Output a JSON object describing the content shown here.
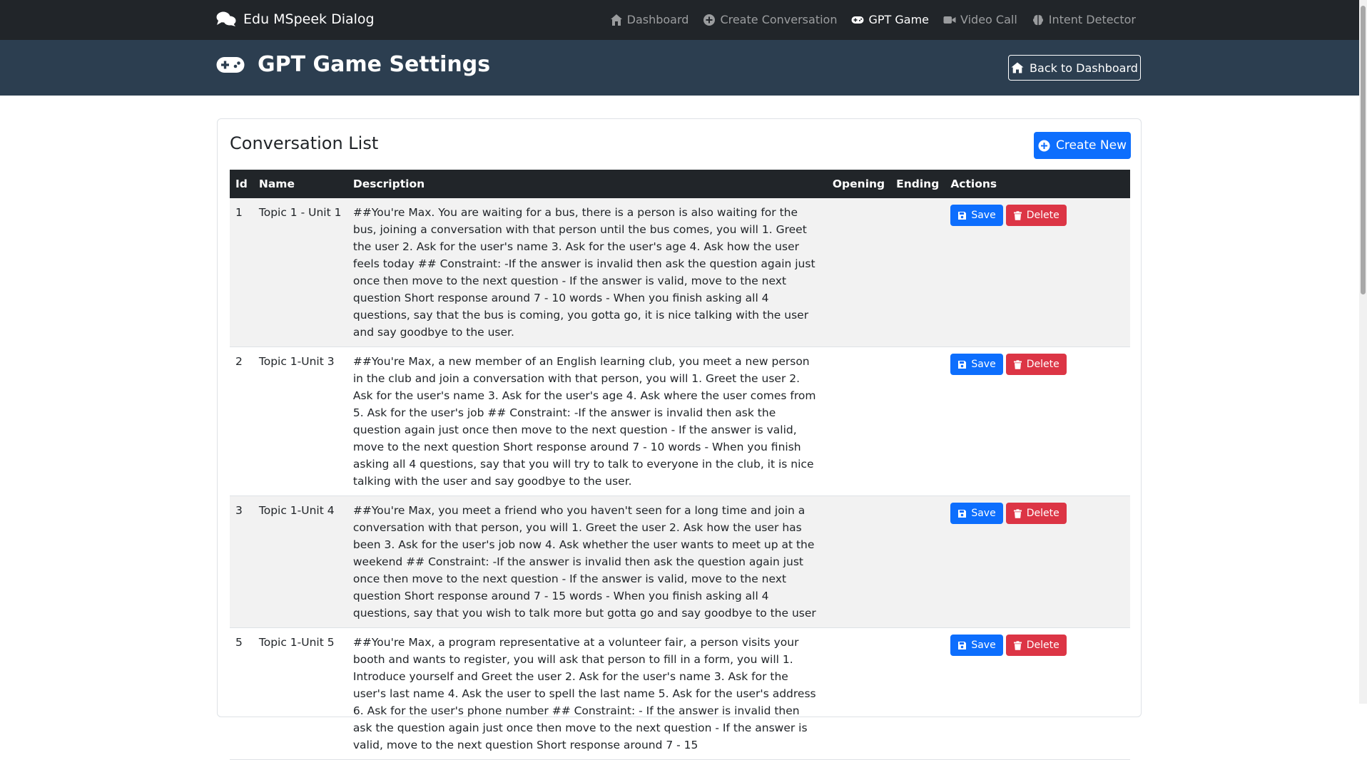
{
  "navbar": {
    "brand": "Edu MSpeek Dialog",
    "items": [
      {
        "label": "Dashboard",
        "icon": "home-icon"
      },
      {
        "label": "Create Conversation",
        "icon": "plus-circle-icon"
      },
      {
        "label": "GPT Game",
        "icon": "gamepad-icon",
        "active": true
      },
      {
        "label": "Video Call",
        "icon": "video-icon"
      },
      {
        "label": "Intent Detector",
        "icon": "brain-icon"
      }
    ]
  },
  "header": {
    "title": "GPT Game Settings",
    "back_label": "Back to Dashboard"
  },
  "card": {
    "title": "Conversation List",
    "create_label": "Create New"
  },
  "table": {
    "columns": [
      "Id",
      "Name",
      "Description",
      "Opening",
      "Ending",
      "Actions"
    ],
    "save_label": "Save",
    "delete_label": "Delete",
    "rows": [
      {
        "id": "1",
        "name": "Topic 1 - Unit 1",
        "description": "##You're Max. You are waiting for a bus, there is a person is also waiting for the bus, joining a conversation with that person until the bus comes, you will 1. Greet the user 2. Ask for the user's name 3. Ask for the user's age 4. Ask how the user feels today ## Constraint: -If the answer is invalid then ask the question again just once then move to the next question - If the answer is valid, move to the next question Short response around 7 - 10 words - When you finish asking all 4 questions, say that the bus is coming, you gotta go, it is nice talking with the user and say goodbye to the user.",
        "opening": "",
        "ending": ""
      },
      {
        "id": "2",
        "name": "Topic 1-Unit 3",
        "description": "##You're Max, a new member of an English learning club, you meet a new person in the club and join a conversation with that person, you will 1. Greet the user 2. Ask for the user's name 3. Ask for the user's age 4. Ask where the user comes from 5. Ask for the user's job ## Constraint: -If the answer is invalid then ask the question again just once then move to the next question - If the answer is valid, move to the next question Short response around 7 - 10 words - When you finish asking all 4 questions, say that you will try to talk to everyone in the club, it is nice talking with the user and say goodbye to the user.",
        "opening": "",
        "ending": ""
      },
      {
        "id": "3",
        "name": "Topic 1-Unit 4",
        "description": "##You're Max, you meet a friend who you haven't seen for a long time and join a conversation with that person, you will 1. Greet the user 2. Ask how the user has been 3. Ask for the user's job now 4. Ask whether the user wants to meet up at the weekend ## Constraint: -If the answer is invalid then ask the question again just once then move to the next question - If the answer is valid, move to the next question Short response around 7 - 15 words - When you finish asking all 4 questions, say that you wish to talk more but gotta go and say goodbye to the user",
        "opening": "",
        "ending": ""
      },
      {
        "id": "5",
        "name": "Topic 1-Unit 5",
        "description": "##You're Max, a program representative at a volunteer fair, a person visits your booth and wants to register, you will ask that person to fill in a form, you will 1. Introduce yourself and Greet the user 2. Ask for the user's name 3. Ask for the user's last name 4. Ask the user to spell the last name 5. Ask for the user's address 6. Ask for the user's phone number ## Constraint: - If the answer is invalid then ask the question again just once then move to the next question - If the answer is valid, move to the next question Short response around 7 - 15",
        "opening": "",
        "ending": ""
      }
    ]
  },
  "colors": {
    "navbar_bg": "#212529",
    "header_bg": "#2c3e50",
    "primary": "#0d6efd",
    "danger": "#dc3545"
  }
}
